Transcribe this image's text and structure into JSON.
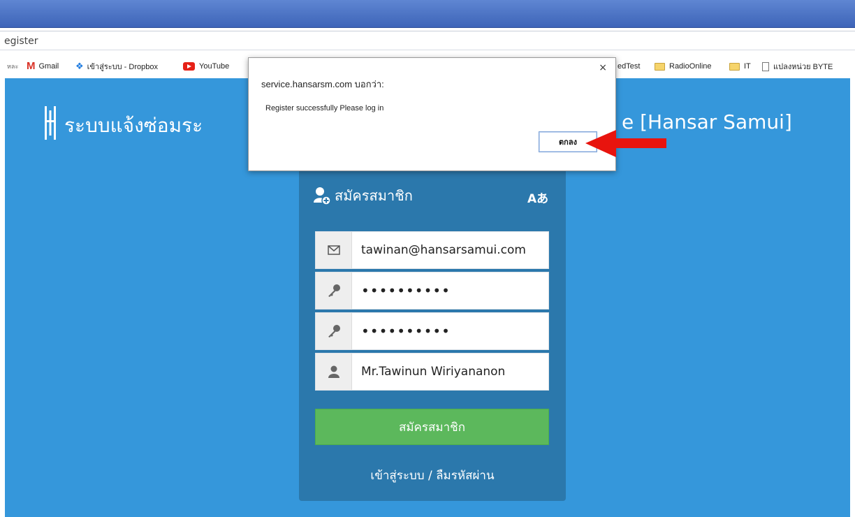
{
  "browser": {
    "address": "egister",
    "bookmarks": [
      {
        "label": "หละ",
        "icon": "truncated"
      },
      {
        "label": "Gmail",
        "icon": "gmail-icon"
      },
      {
        "label": "เข้าสู่ระบบ - Dropbox",
        "icon": "dropbox-icon"
      },
      {
        "label": "YouTube",
        "icon": "youtube-icon"
      },
      {
        "label": "edTest",
        "icon": "truncated"
      },
      {
        "label": "RadioOnline",
        "icon": "folder-icon"
      },
      {
        "label": "IT",
        "icon": "folder-icon"
      },
      {
        "label": "แปลงหน่วย BYTE",
        "icon": "page-icon"
      }
    ]
  },
  "site": {
    "title_left": "ระบบแจ้งซ่อมระ",
    "title_right": "e [Hansar Samui]"
  },
  "form": {
    "heading": "สมัครสมาชิก",
    "lang_icon": "Aあ",
    "email": "tawinan@hansarsamui.com",
    "password": "••••••••••",
    "confirm_password": "••••••••••",
    "name": "Mr.Tawinun Wiriyananon",
    "submit_label": "สมัครสมาชิก",
    "login_link": "เข้าสู่ระบบ / ลืมรหัสผ่าน"
  },
  "dialog": {
    "title": "service.hansarsm.com บอกว่า:",
    "message": "Register successfully Please log in",
    "ok_label": "ตกลง",
    "close_glyph": "×"
  },
  "colors": {
    "page_bg": "#3597db",
    "panel_bg": "#2b78ac",
    "submit_bg": "#5cb85c",
    "arrow": "#e8140e"
  }
}
